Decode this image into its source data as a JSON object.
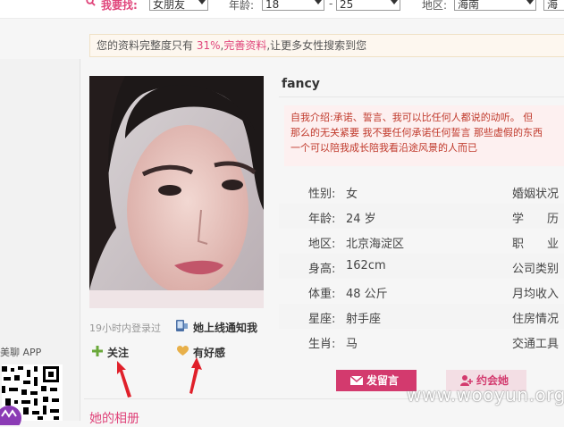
{
  "search": {
    "label": "我要找:",
    "gender_value": "女朋友",
    "age_label": "年龄:",
    "age_min": "18",
    "age_sep": "-",
    "age_max": "25",
    "region_label": "地区:",
    "province_value": "海南",
    "city_value": "海"
  },
  "notice": {
    "prefix": "您的资料完整度只有",
    "percent": "31%",
    "comma": ",",
    "link": "完善资料",
    "suffix": ",让更多女性搜索到您"
  },
  "profile": {
    "nickname": "fancy",
    "bio_lines": [
      "自我介绍:承诺、誓言、我可以比任何人都说的动听。 但",
      "那么的无关紧要 我不要任何承诺任何誓言 那些虚假的东西",
      "一个可以陪我成长陪我看沿途风景的人而已"
    ],
    "login_time": "19小时内登录过",
    "notify_label": "她上线通知我",
    "follow_label": "关注",
    "like_label": "有好感"
  },
  "info_rows": [
    {
      "label": "性别:",
      "value": "女",
      "label2": "婚姻状况"
    },
    {
      "label": "年龄:",
      "value": "24 岁",
      "label2": "学　　历"
    },
    {
      "label": "地区:",
      "value": "北京海淀区",
      "label2": "职　　业"
    },
    {
      "label": "身高:",
      "value": "162cm",
      "label2": "公司类别"
    },
    {
      "label": "体重:",
      "value": "48 公斤",
      "label2": "月均收入"
    },
    {
      "label": "星座:",
      "value": "射手座",
      "label2": "住房情况"
    },
    {
      "label": "生肖:",
      "value": "马",
      "label2": "交通工具"
    }
  ],
  "buttons": {
    "message": "发留言",
    "date": "约会她"
  },
  "app": {
    "label": "美聊 APP"
  },
  "album": {
    "title": "她的相册"
  },
  "watermark": "www.wooyun.org",
  "colors": {
    "accent": "#e0457b",
    "button": "#d33a6e",
    "bio_text": "#c0392b"
  }
}
